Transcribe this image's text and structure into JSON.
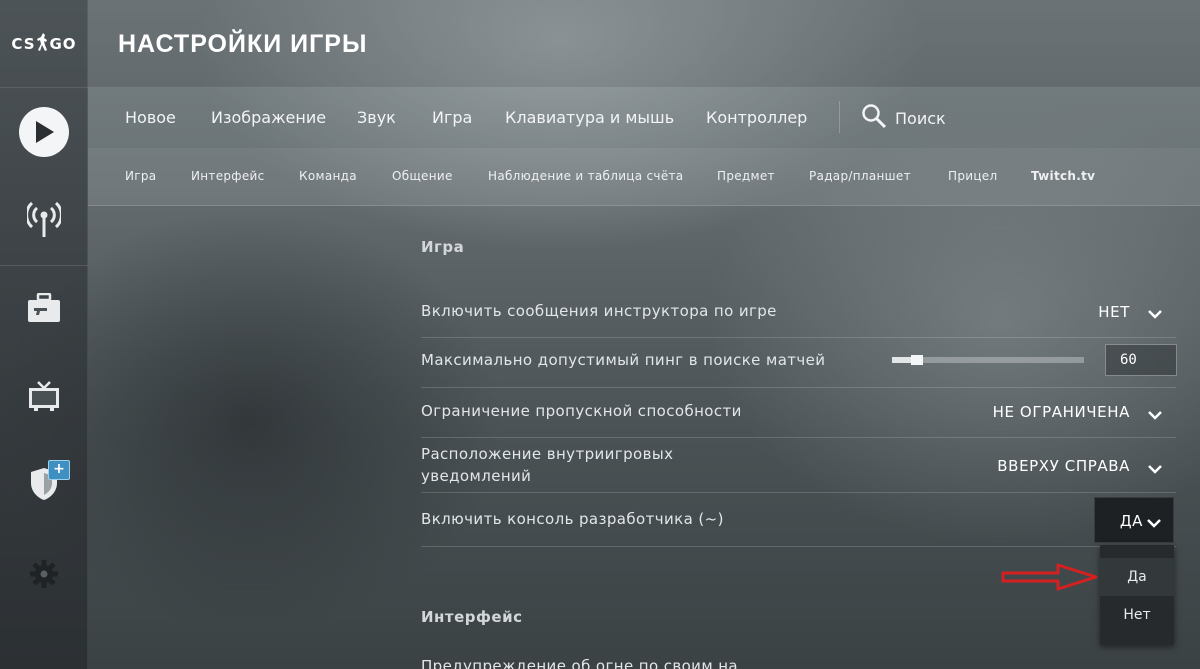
{
  "sidebar": {
    "logo": {
      "left": "CS",
      "right": "GO"
    },
    "items": [
      {
        "name": "play",
        "icon": "play-icon"
      },
      {
        "name": "watch",
        "icon": "broadcast-icon"
      },
      {
        "name": "inventory",
        "icon": "briefcase-icon"
      },
      {
        "name": "tv",
        "icon": "tv-icon"
      },
      {
        "name": "operations",
        "icon": "shield-icon",
        "badge": "+"
      },
      {
        "name": "settings",
        "icon": "gear-icon"
      }
    ]
  },
  "header": {
    "title": "НАСТРОЙКИ ИГРЫ"
  },
  "tabs": {
    "items": [
      "Новое",
      "Изображение",
      "Звук",
      "Игра",
      "Клавиатура и мышь",
      "Контроллер"
    ],
    "search_label": "Поиск"
  },
  "subtabs": {
    "items": [
      "Игра",
      "Интерфейс",
      "Команда",
      "Общение",
      "Наблюдение и таблица счёта",
      "Предмет",
      "Радар/планшет",
      "Прицел",
      "Twitch.tv"
    ]
  },
  "content": {
    "section_game": "Игра",
    "rows": [
      {
        "label": "Включить сообщения инструктора по игре",
        "value": "НЕТ"
      },
      {
        "label": "Максимально допустимый пинг в поиске матчей",
        "value": "60"
      },
      {
        "label": "Ограничение пропускной способности",
        "value": "НЕ ОГРАНИЧЕНА"
      },
      {
        "label": "Расположение внутриигровых уведомлений",
        "value": "ВВЕРХУ СПРАВА"
      },
      {
        "label": "Включить консоль разработчика (~)",
        "value": "ДА"
      }
    ],
    "ping_slider": {
      "value": 60,
      "fraction": 0.13
    },
    "dropdown_options": [
      "Да",
      "Нет"
    ],
    "section_interface": "Интерфейс",
    "next_row_partial": "Предупреждение об огне по своим на"
  },
  "colors": {
    "annotation_arrow": "#d42020",
    "badge": "#3f8fc1"
  }
}
